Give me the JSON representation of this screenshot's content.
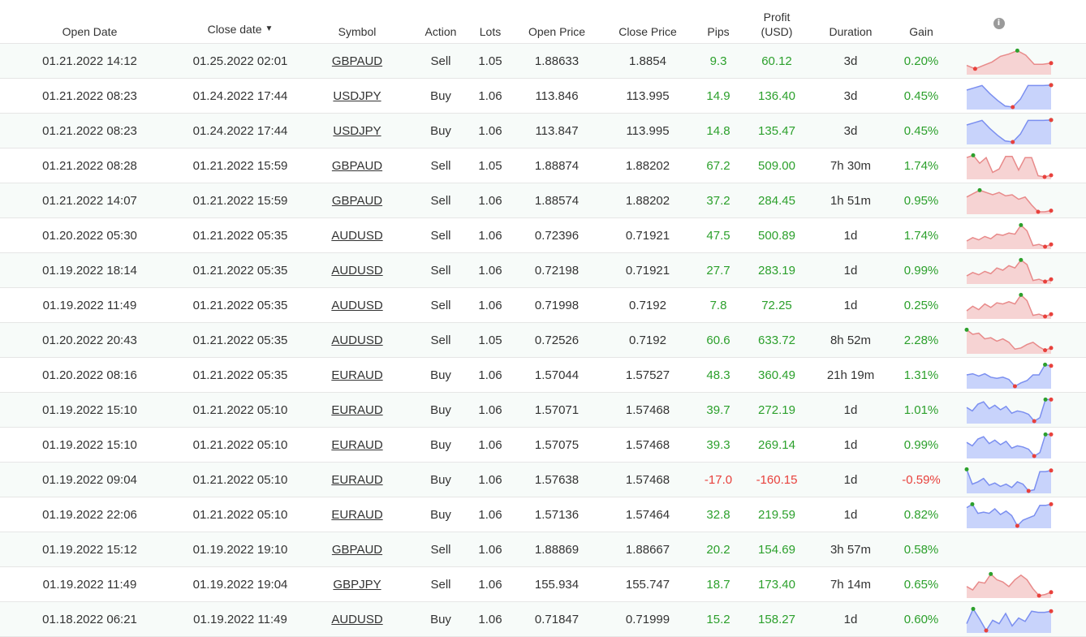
{
  "headers": {
    "open_date": "Open Date",
    "close_date": "Close date",
    "sort_indicator": "▼",
    "symbol": "Symbol",
    "action": "Action",
    "lots": "Lots",
    "open_price": "Open Price",
    "close_price": "Close Price",
    "pips": "Pips",
    "profit_line1": "Profit",
    "profit_line2": "(USD)",
    "duration": "Duration",
    "gain": "Gain",
    "info_icon": "i"
  },
  "colors": {
    "positive": "#2ca02c",
    "negative": "#e8413c",
    "spark_sell_fill": "#f6d3d3",
    "spark_sell_line": "#e88a8a",
    "spark_buy_fill": "#c8d3fb",
    "spark_buy_line": "#7b8ff0",
    "spark_max_dot": "#2ca02c",
    "spark_min_dot": "#e8413c"
  },
  "trades": [
    {
      "open": "01.21.2022 14:12",
      "close": "01.25.2022 02:01",
      "symbol": "GBPAUD",
      "action": "Sell",
      "lots": "1.05",
      "open_price": "1.88633",
      "close_price": "1.8854",
      "pips": "9.3",
      "profit": "60.12",
      "duration": "3d",
      "gain": "0.20%",
      "positive": true,
      "spark": [
        0.3,
        0.15,
        0.3,
        0.45,
        0.7,
        0.8,
        0.95,
        0.75,
        0.35,
        0.35,
        0.4
      ]
    },
    {
      "open": "01.21.2022 08:23",
      "close": "01.24.2022 17:44",
      "symbol": "USDJPY",
      "action": "Buy",
      "lots": "1.06",
      "open_price": "113.846",
      "close_price": "113.995",
      "pips": "14.9",
      "profit": "136.40",
      "duration": "3d",
      "gain": "0.45%",
      "positive": true,
      "spark": [
        0.75,
        0.85,
        0.95,
        0.6,
        0.3,
        0.05,
        0.0,
        0.35,
        0.95,
        0.95,
        0.95,
        0.97
      ]
    },
    {
      "open": "01.21.2022 08:23",
      "close": "01.24.2022 17:44",
      "symbol": "USDJPY",
      "action": "Buy",
      "lots": "1.06",
      "open_price": "113.847",
      "close_price": "113.995",
      "pips": "14.8",
      "profit": "135.47",
      "duration": "3d",
      "gain": "0.45%",
      "positive": true,
      "spark": [
        0.75,
        0.85,
        0.95,
        0.6,
        0.3,
        0.05,
        0.0,
        0.35,
        0.95,
        0.95,
        0.95,
        0.97
      ]
    },
    {
      "open": "01.21.2022 08:28",
      "close": "01.21.2022 15:59",
      "symbol": "GBPAUD",
      "action": "Sell",
      "lots": "1.05",
      "open_price": "1.88874",
      "close_price": "1.88202",
      "pips": "67.2",
      "profit": "509.00",
      "duration": "7h 30m",
      "gain": "1.74%",
      "positive": true,
      "spark": [
        0.85,
        0.95,
        0.6,
        0.85,
        0.2,
        0.35,
        0.9,
        0.9,
        0.3,
        0.85,
        0.85,
        0.05,
        0.0,
        0.07
      ]
    },
    {
      "open": "01.21.2022 14:07",
      "close": "01.21.2022 15:59",
      "symbol": "GBPAUD",
      "action": "Sell",
      "lots": "1.06",
      "open_price": "1.88574",
      "close_price": "1.88202",
      "pips": "37.2",
      "profit": "284.45",
      "duration": "1h 51m",
      "gain": "0.95%",
      "positive": true,
      "spark": [
        0.65,
        0.8,
        0.95,
        0.85,
        0.75,
        0.85,
        0.7,
        0.75,
        0.55,
        0.65,
        0.3,
        0.0,
        0.0,
        0.05
      ]
    },
    {
      "open": "01.20.2022 05:30",
      "close": "01.21.2022 05:35",
      "symbol": "AUDUSD",
      "action": "Sell",
      "lots": "1.06",
      "open_price": "0.72396",
      "close_price": "0.71921",
      "pips": "47.5",
      "profit": "500.89",
      "duration": "1d",
      "gain": "1.74%",
      "positive": true,
      "spark": [
        0.25,
        0.4,
        0.3,
        0.45,
        0.35,
        0.55,
        0.5,
        0.6,
        0.55,
        0.95,
        0.7,
        0.05,
        0.1,
        0.0,
        0.1
      ]
    },
    {
      "open": "01.19.2022 18:14",
      "close": "01.21.2022 05:35",
      "symbol": "AUDUSD",
      "action": "Sell",
      "lots": "1.06",
      "open_price": "0.72198",
      "close_price": "0.71921",
      "pips": "27.7",
      "profit": "283.19",
      "duration": "1d",
      "gain": "0.99%",
      "positive": true,
      "spark": [
        0.25,
        0.4,
        0.3,
        0.45,
        0.35,
        0.6,
        0.5,
        0.7,
        0.6,
        0.95,
        0.75,
        0.05,
        0.1,
        0.0,
        0.1
      ]
    },
    {
      "open": "01.19.2022 11:49",
      "close": "01.21.2022 05:35",
      "symbol": "AUDUSD",
      "action": "Sell",
      "lots": "1.06",
      "open_price": "0.71998",
      "close_price": "0.7192",
      "pips": "7.8",
      "profit": "72.25",
      "duration": "1d",
      "gain": "0.25%",
      "positive": true,
      "spark": [
        0.25,
        0.45,
        0.3,
        0.55,
        0.4,
        0.6,
        0.55,
        0.65,
        0.55,
        0.95,
        0.7,
        0.05,
        0.1,
        0.0,
        0.1
      ]
    },
    {
      "open": "01.20.2022 20:43",
      "close": "01.21.2022 05:35",
      "symbol": "AUDUSD",
      "action": "Sell",
      "lots": "1.05",
      "open_price": "0.72526",
      "close_price": "0.7192",
      "pips": "60.6",
      "profit": "633.72",
      "duration": "8h 52m",
      "gain": "2.28%",
      "positive": true,
      "spark": [
        0.95,
        0.75,
        0.8,
        0.55,
        0.6,
        0.45,
        0.55,
        0.4,
        0.1,
        0.15,
        0.3,
        0.4,
        0.2,
        0.05,
        0.15
      ]
    },
    {
      "open": "01.20.2022 08:16",
      "close": "01.21.2022 05:35",
      "symbol": "EURAUD",
      "action": "Buy",
      "lots": "1.06",
      "open_price": "1.57044",
      "close_price": "1.57527",
      "pips": "48.3",
      "profit": "360.49",
      "duration": "21h 19m",
      "gain": "1.31%",
      "positive": true,
      "spark": [
        0.5,
        0.55,
        0.45,
        0.55,
        0.4,
        0.35,
        0.4,
        0.3,
        0.0,
        0.15,
        0.25,
        0.5,
        0.5,
        0.95,
        0.9
      ]
    },
    {
      "open": "01.19.2022 15:10",
      "close": "01.21.2022 05:10",
      "symbol": "EURAUD",
      "action": "Buy",
      "lots": "1.06",
      "open_price": "1.57071",
      "close_price": "1.57468",
      "pips": "39.7",
      "profit": "272.19",
      "duration": "1d",
      "gain": "1.01%",
      "positive": true,
      "spark": [
        0.6,
        0.45,
        0.75,
        0.85,
        0.55,
        0.7,
        0.5,
        0.65,
        0.35,
        0.45,
        0.4,
        0.3,
        0.0,
        0.15,
        0.95,
        0.95
      ]
    },
    {
      "open": "01.19.2022 15:10",
      "close": "01.21.2022 05:10",
      "symbol": "EURAUD",
      "action": "Buy",
      "lots": "1.06",
      "open_price": "1.57075",
      "close_price": "1.57468",
      "pips": "39.3",
      "profit": "269.14",
      "duration": "1d",
      "gain": "0.99%",
      "positive": true,
      "spark": [
        0.6,
        0.45,
        0.75,
        0.85,
        0.55,
        0.7,
        0.5,
        0.65,
        0.35,
        0.45,
        0.4,
        0.3,
        0.0,
        0.15,
        0.95,
        0.95
      ]
    },
    {
      "open": "01.19.2022 09:04",
      "close": "01.21.2022 05:10",
      "symbol": "EURAUD",
      "action": "Buy",
      "lots": "1.06",
      "open_price": "1.57638",
      "close_price": "1.57468",
      "pips": "-17.0",
      "profit": "-160.15",
      "duration": "1d",
      "gain": "-0.59%",
      "positive": false,
      "spark": [
        0.95,
        0.3,
        0.4,
        0.55,
        0.25,
        0.35,
        0.2,
        0.3,
        0.15,
        0.4,
        0.3,
        0.0,
        0.05,
        0.85,
        0.85,
        0.9
      ]
    },
    {
      "open": "01.19.2022 22:06",
      "close": "01.21.2022 05:10",
      "symbol": "EURAUD",
      "action": "Buy",
      "lots": "1.06",
      "open_price": "1.57136",
      "close_price": "1.57464",
      "pips": "32.8",
      "profit": "219.59",
      "duration": "1d",
      "gain": "0.82%",
      "positive": true,
      "spark": [
        0.8,
        0.95,
        0.55,
        0.6,
        0.55,
        0.75,
        0.5,
        0.65,
        0.45,
        0.0,
        0.25,
        0.35,
        0.45,
        0.9,
        0.9,
        0.95
      ]
    },
    {
      "open": "01.19.2022 15:12",
      "close": "01.19.2022 19:10",
      "symbol": "GBPAUD",
      "action": "Sell",
      "lots": "1.06",
      "open_price": "1.88869",
      "close_price": "1.88667",
      "pips": "20.2",
      "profit": "154.69",
      "duration": "3h 57m",
      "gain": "0.58%",
      "positive": true,
      "spark": null
    },
    {
      "open": "01.19.2022 11:49",
      "close": "01.19.2022 19:04",
      "symbol": "GBPJPY",
      "action": "Sell",
      "lots": "1.06",
      "open_price": "155.934",
      "close_price": "155.747",
      "pips": "18.7",
      "profit": "173.40",
      "duration": "7h 14m",
      "gain": "0.65%",
      "positive": true,
      "spark": [
        0.4,
        0.25,
        0.6,
        0.55,
        0.95,
        0.7,
        0.6,
        0.4,
        0.7,
        0.9,
        0.7,
        0.3,
        0.0,
        0.05,
        0.15
      ]
    },
    {
      "open": "01.18.2022 06:21",
      "close": "01.19.2022 11:49",
      "symbol": "AUDUSD",
      "action": "Buy",
      "lots": "1.06",
      "open_price": "0.71847",
      "close_price": "0.71999",
      "pips": "15.2",
      "profit": "158.27",
      "duration": "1d",
      "gain": "0.60%",
      "positive": true,
      "spark": [
        0.3,
        0.95,
        0.5,
        0.0,
        0.45,
        0.3,
        0.75,
        0.2,
        0.55,
        0.4,
        0.85,
        0.8,
        0.8,
        0.85
      ]
    }
  ]
}
